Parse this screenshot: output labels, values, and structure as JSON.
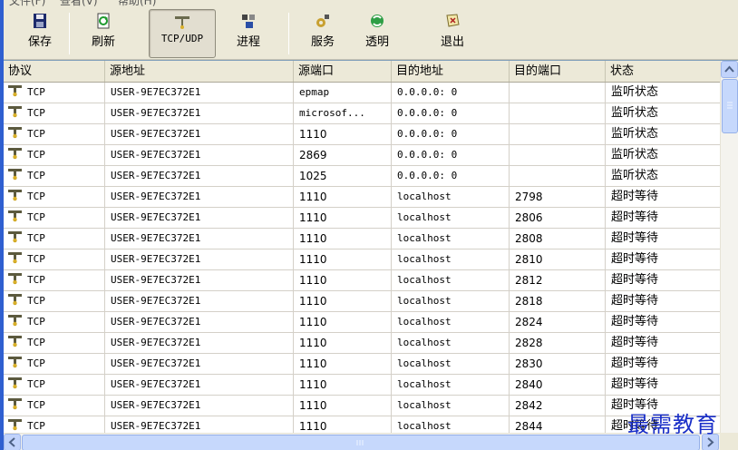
{
  "menu": [
    {
      "label": "文件(F)"
    },
    {
      "label": "查看(V)"
    },
    {
      "label": "帮助(H)"
    }
  ],
  "toolbar": {
    "buttons": [
      {
        "label": "保存",
        "icon": "floppy-disk-icon"
      },
      {
        "label": "刷新",
        "icon": "refresh-icon"
      },
      {
        "label": "TCP/UDP",
        "icon": "network-plug-icon",
        "pressed": true
      },
      {
        "label": "进程",
        "icon": "process-icon"
      },
      {
        "label": "服务",
        "icon": "service-icon"
      },
      {
        "label": "透明",
        "icon": "transparent-icon"
      },
      {
        "label": "退出",
        "icon": "exit-icon"
      }
    ]
  },
  "table": {
    "columns": [
      "协议",
      "源地址",
      "源端口",
      "目的地址",
      "目的端口",
      "状态"
    ],
    "rows": [
      {
        "protocol": "TCP",
        "src": "USER-9E7EC372E1",
        "sport": "epmap",
        "dst": "0.0.0.0: 0",
        "dport": "",
        "state": "监听状态"
      },
      {
        "protocol": "TCP",
        "src": "USER-9E7EC372E1",
        "sport": "microsof...",
        "dst": "0.0.0.0: 0",
        "dport": "",
        "state": "监听状态"
      },
      {
        "protocol": "TCP",
        "src": "USER-9E7EC372E1",
        "sport": "1110",
        "dst": "0.0.0.0: 0",
        "dport": "",
        "state": "监听状态"
      },
      {
        "protocol": "TCP",
        "src": "USER-9E7EC372E1",
        "sport": "2869",
        "dst": "0.0.0.0: 0",
        "dport": "",
        "state": "监听状态"
      },
      {
        "protocol": "TCP",
        "src": "USER-9E7EC372E1",
        "sport": "1025",
        "dst": "0.0.0.0: 0",
        "dport": "",
        "state": "监听状态"
      },
      {
        "protocol": "TCP",
        "src": "USER-9E7EC372E1",
        "sport": "1110",
        "dst": "localhost",
        "dport": "2798",
        "state": "超时等待"
      },
      {
        "protocol": "TCP",
        "src": "USER-9E7EC372E1",
        "sport": "1110",
        "dst": "localhost",
        "dport": "2806",
        "state": "超时等待"
      },
      {
        "protocol": "TCP",
        "src": "USER-9E7EC372E1",
        "sport": "1110",
        "dst": "localhost",
        "dport": "2808",
        "state": "超时等待"
      },
      {
        "protocol": "TCP",
        "src": "USER-9E7EC372E1",
        "sport": "1110",
        "dst": "localhost",
        "dport": "2810",
        "state": "超时等待"
      },
      {
        "protocol": "TCP",
        "src": "USER-9E7EC372E1",
        "sport": "1110",
        "dst": "localhost",
        "dport": "2812",
        "state": "超时等待"
      },
      {
        "protocol": "TCP",
        "src": "USER-9E7EC372E1",
        "sport": "1110",
        "dst": "localhost",
        "dport": "2818",
        "state": "超时等待"
      },
      {
        "protocol": "TCP",
        "src": "USER-9E7EC372E1",
        "sport": "1110",
        "dst": "localhost",
        "dport": "2824",
        "state": "超时等待"
      },
      {
        "protocol": "TCP",
        "src": "USER-9E7EC372E1",
        "sport": "1110",
        "dst": "localhost",
        "dport": "2828",
        "state": "超时等待"
      },
      {
        "protocol": "TCP",
        "src": "USER-9E7EC372E1",
        "sport": "1110",
        "dst": "localhost",
        "dport": "2830",
        "state": "超时等待"
      },
      {
        "protocol": "TCP",
        "src": "USER-9E7EC372E1",
        "sport": "1110",
        "dst": "localhost",
        "dport": "2840",
        "state": "超时等待"
      },
      {
        "protocol": "TCP",
        "src": "USER-9E7EC372E1",
        "sport": "1110",
        "dst": "localhost",
        "dport": "2842",
        "state": "超时等待"
      },
      {
        "protocol": "TCP",
        "src": "USER-9E7EC372E1",
        "sport": "1110",
        "dst": "localhost",
        "dport": "2844",
        "state": "超时等待"
      }
    ]
  },
  "watermark": "最需教育",
  "colors": {
    "window_border": "#2f5fd0",
    "watermark": "#1a2fc8",
    "scrollbar": "#c1d3fb"
  }
}
